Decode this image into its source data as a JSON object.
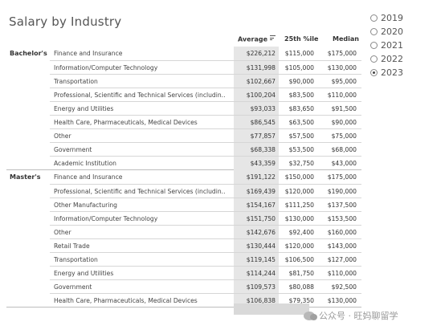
{
  "title": "Salary by Industry",
  "years": [
    {
      "label": "2019",
      "selected": false
    },
    {
      "label": "2020",
      "selected": false
    },
    {
      "label": "2021",
      "selected": false
    },
    {
      "label": "2022",
      "selected": false
    },
    {
      "label": "2023",
      "selected": true
    }
  ],
  "columns": {
    "average": "Average",
    "p25": "25th %ile",
    "median": "Median"
  },
  "groups": [
    {
      "label": "Bachelor's",
      "rows": [
        {
          "industry": "Finance and Insurance",
          "average": "$226,212",
          "p25": "$115,000",
          "median": "$175,000"
        },
        {
          "industry": "Information/Computer Technology",
          "average": "$131,998",
          "p25": "$105,000",
          "median": "$130,000"
        },
        {
          "industry": "Transportation",
          "average": "$102,667",
          "p25": "$90,000",
          "median": "$95,000"
        },
        {
          "industry": "Professional, Scientific and Technical Services (includin..",
          "average": "$100,204",
          "p25": "$83,500",
          "median": "$110,000"
        },
        {
          "industry": "Energy and Utilities",
          "average": "$93,033",
          "p25": "$83,650",
          "median": "$91,500"
        },
        {
          "industry": "Health Care, Pharmaceuticals, Medical Devices",
          "average": "$86,545",
          "p25": "$63,500",
          "median": "$90,000"
        },
        {
          "industry": "Other",
          "average": "$77,857",
          "p25": "$57,500",
          "median": "$75,000"
        },
        {
          "industry": "Government",
          "average": "$68,338",
          "p25": "$53,500",
          "median": "$68,000"
        },
        {
          "industry": "Academic Institution",
          "average": "$43,359",
          "p25": "$32,750",
          "median": "$43,000"
        }
      ]
    },
    {
      "label": "Master's",
      "rows": [
        {
          "industry": "Finance and Insurance",
          "average": "$191,122",
          "p25": "$150,000",
          "median": "$175,000"
        },
        {
          "industry": "Professional, Scientific and Technical Services (includin..",
          "average": "$169,439",
          "p25": "$120,000",
          "median": "$190,000"
        },
        {
          "industry": "Other Manufacturing",
          "average": "$154,167",
          "p25": "$111,250",
          "median": "$137,500"
        },
        {
          "industry": "Information/Computer Technology",
          "average": "$151,750",
          "p25": "$130,000",
          "median": "$153,500"
        },
        {
          "industry": "Other",
          "average": "$142,676",
          "p25": "$92,400",
          "median": "$160,000"
        },
        {
          "industry": "Retail Trade",
          "average": "$130,444",
          "p25": "$120,000",
          "median": "$143,000"
        },
        {
          "industry": "Transportation",
          "average": "$119,145",
          "p25": "$106,500",
          "median": "$127,000"
        },
        {
          "industry": "Energy and Utilities",
          "average": "$114,244",
          "p25": "$81,750",
          "median": "$110,000"
        },
        {
          "industry": "Government",
          "average": "$109,573",
          "p25": "$80,088",
          "median": "$92,500"
        },
        {
          "industry": "Health Care, Pharmaceuticals, Medical Devices",
          "average": "$106,838",
          "p25": "$79,350",
          "median": "$130,000"
        }
      ]
    }
  ],
  "watermark": "公众号 · 旺妈聊留学"
}
